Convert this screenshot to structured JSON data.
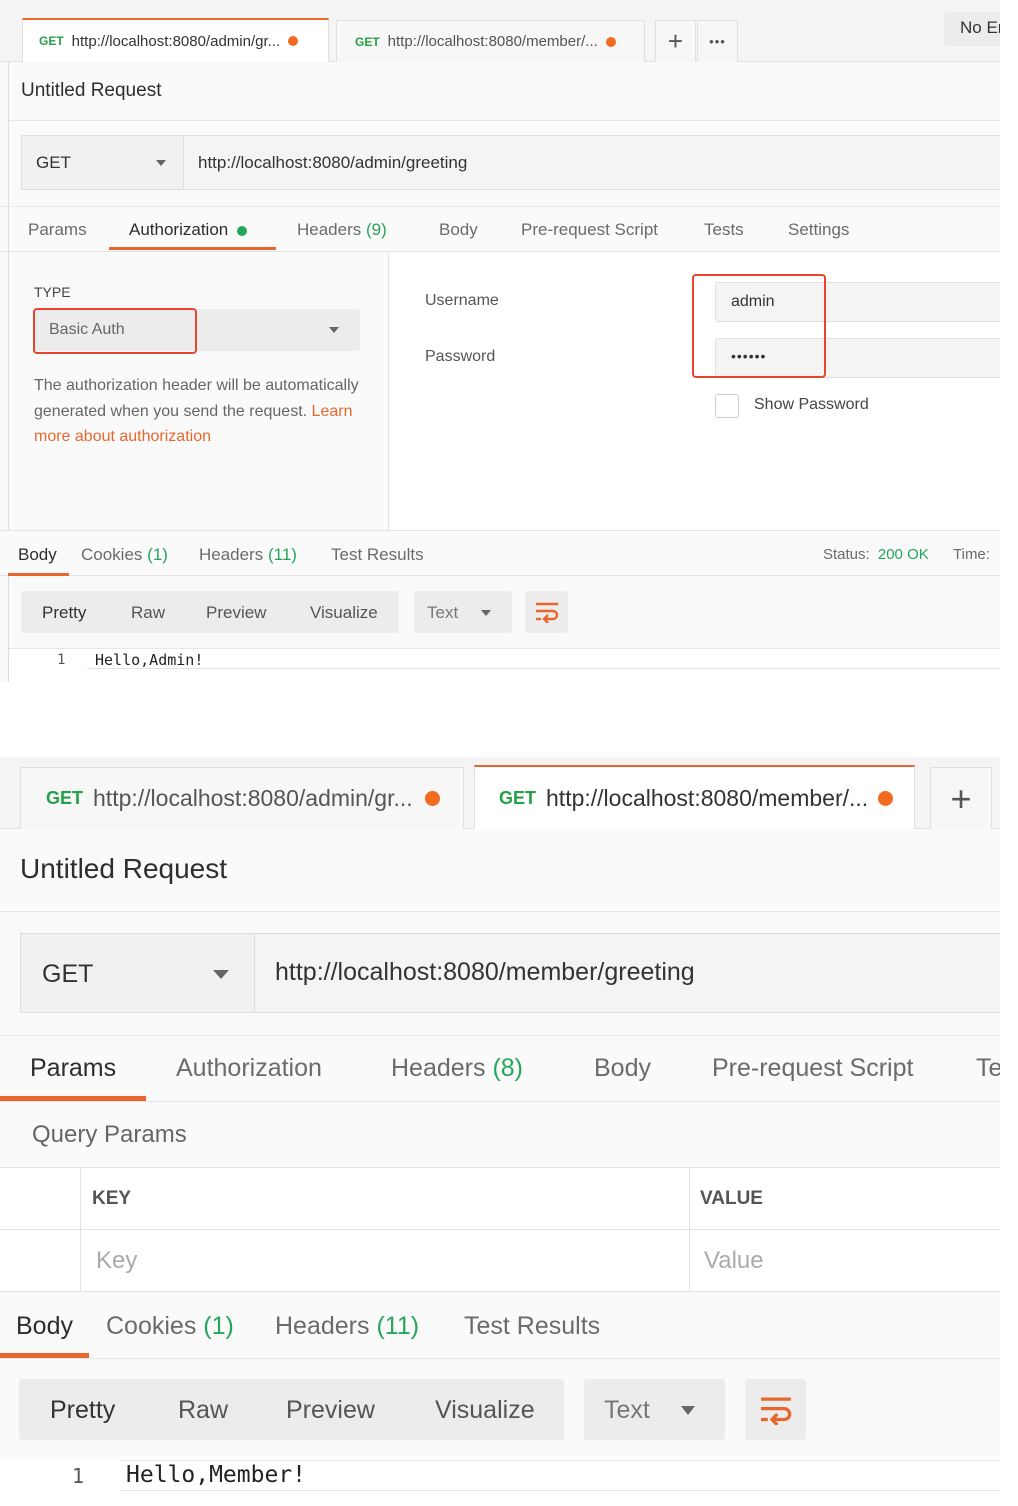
{
  "top": {
    "tabs": [
      {
        "method": "GET",
        "url": "http://localhost:8080/admin/gr..."
      },
      {
        "method": "GET",
        "url": "http://localhost:8080/member/..."
      }
    ],
    "new_tab_symbol": "+",
    "more_symbol": "•••",
    "environment": "No Er",
    "request_title": "Untitled Request",
    "method": "GET",
    "url": "http://localhost:8080/admin/greeting",
    "subtabs": {
      "params": "Params",
      "authorization": "Authorization",
      "headers": "Headers",
      "headers_count": "(9)",
      "body": "Body",
      "prerequest": "Pre-request Script",
      "tests": "Tests",
      "settings": "Settings"
    },
    "auth": {
      "type_label": "TYPE",
      "type_value": "Basic Auth",
      "description": "The authorization header will be automatically generated when you send the request.",
      "learn_more": "Learn more about authorization",
      "username_label": "Username",
      "username_value": "admin",
      "password_label": "Password",
      "password_value": "••••••",
      "show_password": "Show Password"
    },
    "response": {
      "tabs": {
        "body": "Body",
        "cookies": "Cookies",
        "cookies_count": "(1)",
        "headers": "Headers",
        "headers_count": "(11)",
        "test_results": "Test Results"
      },
      "status_label": "Status:",
      "status_value": "200 OK",
      "time_label": "Time:",
      "views": {
        "pretty": "Pretty",
        "raw": "Raw",
        "preview": "Preview",
        "visualize": "Visualize"
      },
      "format": "Text",
      "line_number": "1",
      "content": "Hello,Admin!"
    }
  },
  "bottom": {
    "tabs": [
      {
        "method": "GET",
        "url": "http://localhost:8080/admin/gr..."
      },
      {
        "method": "GET",
        "url": "http://localhost:8080/member/..."
      }
    ],
    "new_tab_symbol": "+",
    "request_title": "Untitled Request",
    "method": "GET",
    "url": "http://localhost:8080/member/greeting",
    "subtabs": {
      "params": "Params",
      "authorization": "Authorization",
      "headers": "Headers",
      "headers_count": "(8)",
      "body": "Body",
      "prerequest": "Pre-request Script",
      "tests_partial": "Te"
    },
    "query_params": {
      "title": "Query Params",
      "key_header": "KEY",
      "value_header": "VALUE",
      "key_placeholder": "Key",
      "value_placeholder": "Value"
    },
    "response": {
      "tabs": {
        "body": "Body",
        "cookies": "Cookies",
        "cookies_count": "(1)",
        "headers": "Headers",
        "headers_count": "(11)",
        "test_results": "Test Results"
      },
      "views": {
        "pretty": "Pretty",
        "raw": "Raw",
        "preview": "Preview",
        "visualize": "Visualize"
      },
      "format": "Text",
      "line_number": "1",
      "content": "Hello,Member!"
    }
  },
  "colors": {
    "accent": "#e8672e",
    "method": "#24a148",
    "count": "#26a65b",
    "highlight": "#e8452e"
  }
}
